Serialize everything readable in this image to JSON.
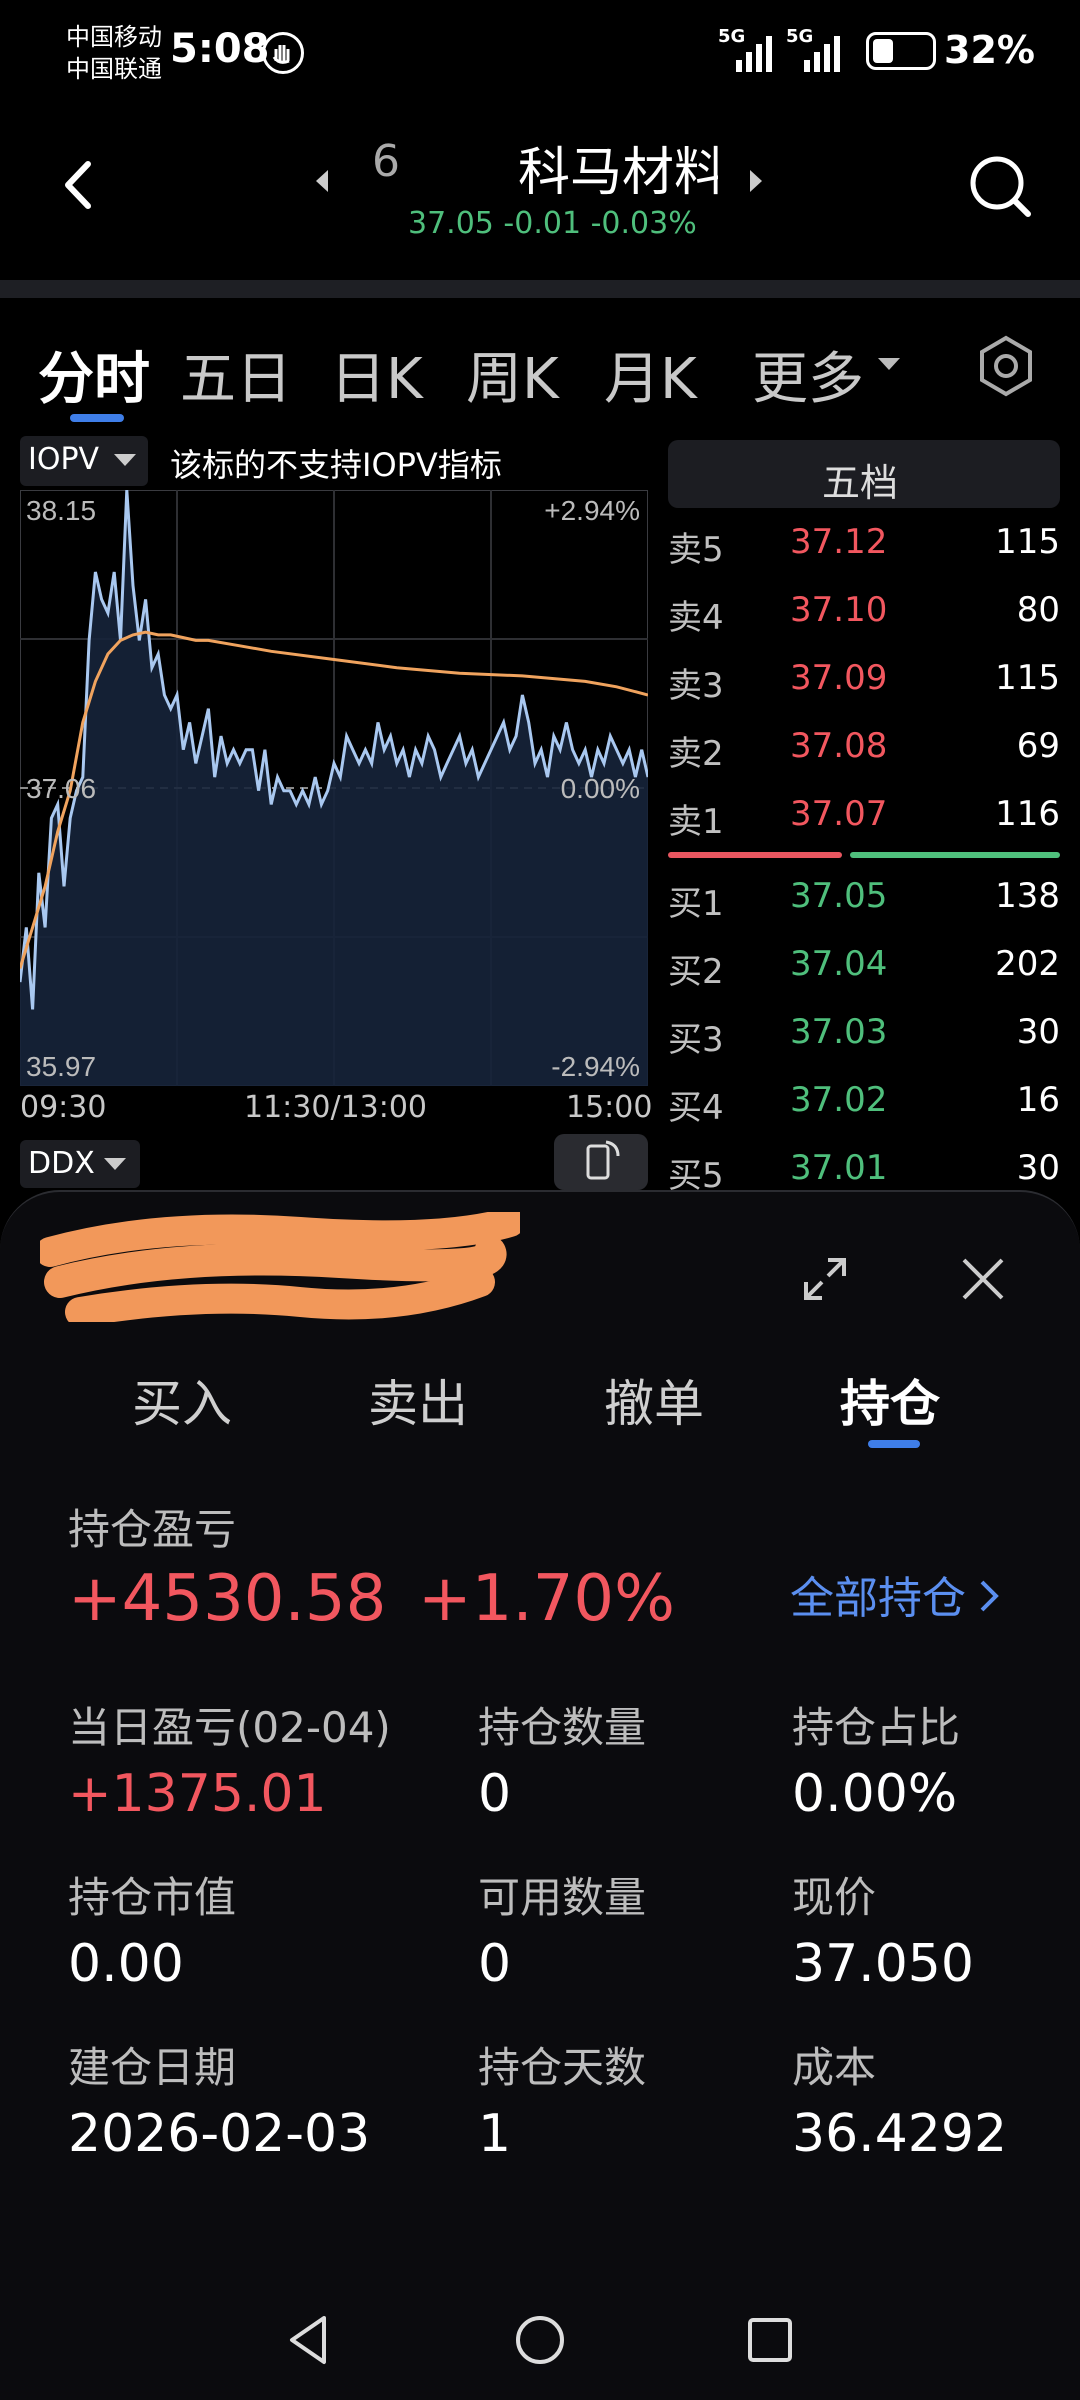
{
  "status_bar": {
    "carrier1": "中国移动",
    "carrier2": "中国联通",
    "time": "5:08",
    "battery": "32%",
    "net1": "5G",
    "net2": "5G"
  },
  "header": {
    "stock_code_partial": "6",
    "stock_name": "科马材料",
    "price_line": "37.05 -0.01 -0.03%"
  },
  "tabs": {
    "items": [
      "分时",
      "五日",
      "日K",
      "周K",
      "月K",
      "更多"
    ],
    "active": "分时"
  },
  "chart_panel": {
    "indicator": "IOPV",
    "notice": "该标的不支持IOPV指标",
    "ydn": "35.97",
    "yup": "38.15",
    "ymid": "37.06",
    "pct_up": "+2.94%",
    "pct_mid": "0.00%",
    "pct_dn": "-2.94%",
    "time_start": "09:30",
    "time_mid": "11:30/13:00",
    "time_end": "15:00",
    "sub_indicator": "DDX"
  },
  "chart_data": {
    "type": "line",
    "ylim": [
      35.97,
      38.15
    ],
    "xlim": [
      0,
      100
    ],
    "x_ticks": [
      "09:30",
      "11:30/13:00",
      "15:00"
    ],
    "y_ticks_left": [
      "38.15",
      "37.06",
      "35.97"
    ],
    "y_ticks_right": [
      "+2.94%",
      "0.00%",
      "-2.94%"
    ],
    "grid": true,
    "series": [
      {
        "color": "#a9c8f0",
        "x": [
          0,
          1,
          2,
          3,
          4,
          5,
          6,
          7,
          8,
          9,
          10,
          11,
          12,
          13,
          14,
          15,
          16,
          17,
          18,
          19,
          20,
          21,
          22,
          23,
          24,
          25,
          26,
          27,
          28,
          29,
          30,
          31,
          32,
          33,
          34,
          35,
          36,
          37,
          38,
          39,
          40,
          41,
          42,
          43,
          44,
          45,
          46,
          47,
          48,
          49,
          50,
          51,
          52,
          53,
          54,
          55,
          56,
          57,
          58,
          59,
          60,
          61,
          62,
          63,
          64,
          65,
          66,
          67,
          68,
          69,
          70,
          71,
          72,
          73,
          74,
          75,
          76,
          77,
          78,
          79,
          80,
          81,
          82,
          83,
          84,
          85,
          86,
          87,
          88,
          89,
          90,
          91,
          92,
          93,
          94,
          95,
          96,
          97,
          98,
          99,
          100
        ],
        "y": [
          36.35,
          36.55,
          36.25,
          36.75,
          36.55,
          36.95,
          37.0,
          36.7,
          36.95,
          37.05,
          37.1,
          37.6,
          37.85,
          37.75,
          37.7,
          37.85,
          37.6,
          38.15,
          37.8,
          37.6,
          37.75,
          37.5,
          37.55,
          37.4,
          37.35,
          37.4,
          37.2,
          37.3,
          37.15,
          37.25,
          37.35,
          37.1,
          37.25,
          37.15,
          37.2,
          37.15,
          37.2,
          37.2,
          37.05,
          37.2,
          37.0,
          37.1,
          37.05,
          37.05,
          37.0,
          37.05,
          37.0,
          37.1,
          37.0,
          37.05,
          37.15,
          37.1,
          37.25,
          37.2,
          37.15,
          37.2,
          37.15,
          37.3,
          37.2,
          37.25,
          37.15,
          37.2,
          37.1,
          37.2,
          37.15,
          37.25,
          37.2,
          37.1,
          37.15,
          37.2,
          37.25,
          37.15,
          37.2,
          37.1,
          37.15,
          37.2,
          37.25,
          37.3,
          37.2,
          37.25,
          37.4,
          37.3,
          37.15,
          37.2,
          37.1,
          37.25,
          37.2,
          37.3,
          37.2,
          37.15,
          37.2,
          37.1,
          37.2,
          37.15,
          37.25,
          37.2,
          37.15,
          37.2,
          37.1,
          37.2,
          37.1
        ]
      },
      {
        "color": "#f0a35e",
        "x": [
          0,
          2,
          4,
          6,
          8,
          10,
          12,
          14,
          16,
          18,
          20,
          22,
          24,
          26,
          28,
          30,
          35,
          40,
          50,
          60,
          70,
          80,
          90,
          95,
          100
        ],
        "y": [
          36.4,
          36.55,
          36.7,
          36.9,
          37.05,
          37.3,
          37.45,
          37.55,
          37.6,
          37.62,
          37.63,
          37.62,
          37.62,
          37.61,
          37.6,
          37.6,
          37.58,
          37.56,
          37.53,
          37.5,
          37.48,
          37.47,
          37.45,
          37.43,
          37.4
        ]
      }
    ]
  },
  "order_book": {
    "title": "五档",
    "asks": [
      {
        "label": "卖5",
        "price": "37.12",
        "volume": "115"
      },
      {
        "label": "卖4",
        "price": "37.10",
        "volume": "80"
      },
      {
        "label": "卖3",
        "price": "37.09",
        "volume": "115"
      },
      {
        "label": "卖2",
        "price": "37.08",
        "volume": "69"
      },
      {
        "label": "卖1",
        "price": "37.07",
        "volume": "116"
      }
    ],
    "bids": [
      {
        "label": "买1",
        "price": "37.05",
        "volume": "138"
      },
      {
        "label": "买2",
        "price": "37.04",
        "volume": "202"
      },
      {
        "label": "买3",
        "price": "37.03",
        "volume": "30"
      },
      {
        "label": "买4",
        "price": "37.02",
        "volume": "16"
      },
      {
        "label": "买5",
        "price": "37.01",
        "volume": "30"
      }
    ]
  },
  "trade_panel": {
    "tabs": [
      "买入",
      "卖出",
      "撤单",
      "持仓"
    ],
    "active_tab": "持仓",
    "pnl_label": "持仓盈亏",
    "pnl_value": "+4530.58",
    "pnl_pct": "+1.70%",
    "all_positions": "全部持仓",
    "grid": [
      {
        "label": "当日盈亏(02-04)",
        "value": "+1375.01",
        "color": "red"
      },
      {
        "label": "持仓数量",
        "value": "0",
        "color": "white"
      },
      {
        "label": "持仓占比",
        "value": "0.00%",
        "color": "white"
      },
      {
        "label": "持仓市值",
        "value": "0.00",
        "color": "white"
      },
      {
        "label": "可用数量",
        "value": "0",
        "color": "white"
      },
      {
        "label": "现价",
        "value": "37.050",
        "color": "white"
      },
      {
        "label": "建仓日期",
        "value": "2026-02-03",
        "color": "white"
      },
      {
        "label": "持仓天数",
        "value": "1",
        "color": "white"
      },
      {
        "label": "成本",
        "value": "36.4292",
        "color": "white"
      }
    ]
  }
}
